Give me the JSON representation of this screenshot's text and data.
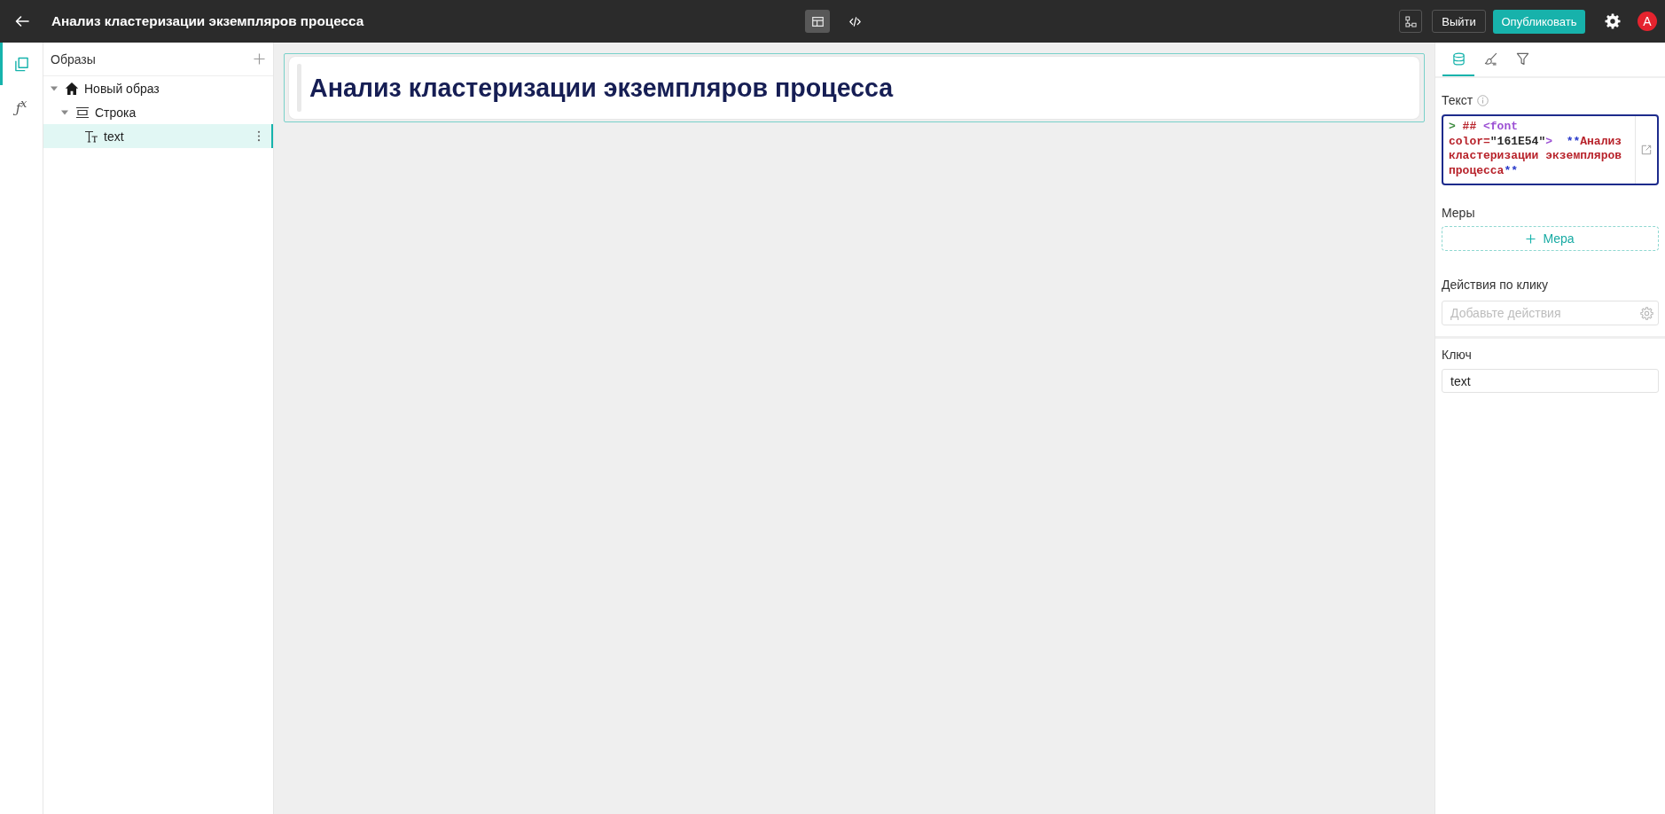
{
  "topbar": {
    "title": "Анализ кластеризации экземпляров процесса",
    "view_modes": [
      {
        "kind": "visual",
        "selected": true
      },
      {
        "kind": "code",
        "selected": false
      }
    ],
    "buttons": [
      {
        "label": "Выйти",
        "kind": "outline"
      },
      {
        "label": "Опубликовать",
        "kind": "primary"
      }
    ],
    "avatar": "A"
  },
  "rail": [
    {
      "kind": "pages",
      "selected": true
    },
    {
      "kind": "formula",
      "glyph": "ƒ$^{x}$",
      "selected": false
    }
  ],
  "tree": {
    "title": "Образы",
    "items": [
      {
        "label": "Новый образ",
        "kind": "page",
        "expanded": true,
        "selected": false,
        "children": [
          {
            "label": "Строка",
            "kind": "row",
            "expanded": true,
            "selected": false,
            "children": [
              {
                "label": "text",
                "kind": "text",
                "selected": true
              }
            ]
          }
        ]
      }
    ]
  },
  "canvas": {
    "widgets": [
      {
        "kind": "text",
        "heading": "Анализ кластеризации экземпляров процесса",
        "selected": true
      }
    ]
  },
  "inspector": {
    "tabs": [
      {
        "kind": "data",
        "selected": true
      },
      {
        "kind": "style",
        "selected": false
      },
      {
        "kind": "filter",
        "selected": false
      }
    ],
    "text_field": {
      "label": "Текст",
      "tokens": [
        {
          "text": ">",
          "kind": "quote"
        },
        {
          "text": " ##",
          "kind": "heading"
        },
        {
          "text": " <font",
          "kind": "tag"
        },
        {
          "text": " color=",
          "kind": "attr"
        },
        {
          "text": "\"161E54\"",
          "kind": "string"
        },
        {
          "text": ">",
          "kind": "tag"
        },
        {
          "text": "  **",
          "kind": "bold"
        },
        {
          "text": "Анализ кластеризации экземпляров процесса",
          "kind": "text"
        },
        {
          "text": "**",
          "kind": "bold"
        }
      ]
    },
    "measures": {
      "label": "Меры",
      "button": "Мера"
    },
    "click_actions": {
      "label": "Действия по клику",
      "placeholder": "Добавьте действия"
    },
    "key": {
      "label": "Ключ",
      "value": "text"
    }
  }
}
